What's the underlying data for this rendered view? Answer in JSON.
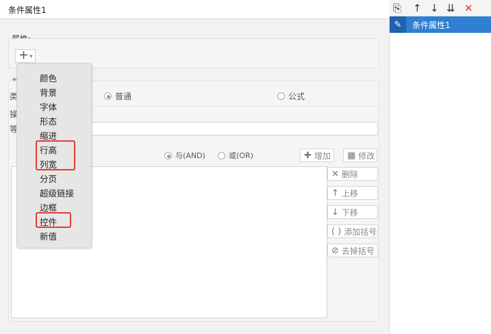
{
  "title": "条件属性1",
  "attr_label": "属性:",
  "add_button": {
    "plus": "+",
    "arrow": "▾"
  },
  "partial_labels": {
    "a": "普",
    "b": "类",
    "c": "操",
    "d": "等"
  },
  "type_radios": {
    "normal": "普通",
    "formula": "公式"
  },
  "logic_radios": {
    "and": "与(AND)",
    "or": "或(OR)"
  },
  "buttons": {
    "add": "增加",
    "modify": "修改",
    "delete": "删除",
    "move_up": "上移",
    "move_down": "下移",
    "add_bracket": "添加括号",
    "remove_bracket": "去掉括号"
  },
  "menu": {
    "items": [
      "颜色",
      "背景",
      "字体",
      "形态",
      "缩进",
      "行高",
      "列宽",
      "分页",
      "超级链接",
      "边框",
      "控件",
      "新值"
    ]
  },
  "right_panel": {
    "item_label": "条件属性1"
  },
  "colors": {
    "accent": "#2f7fd4",
    "highlight": "#e53935"
  }
}
